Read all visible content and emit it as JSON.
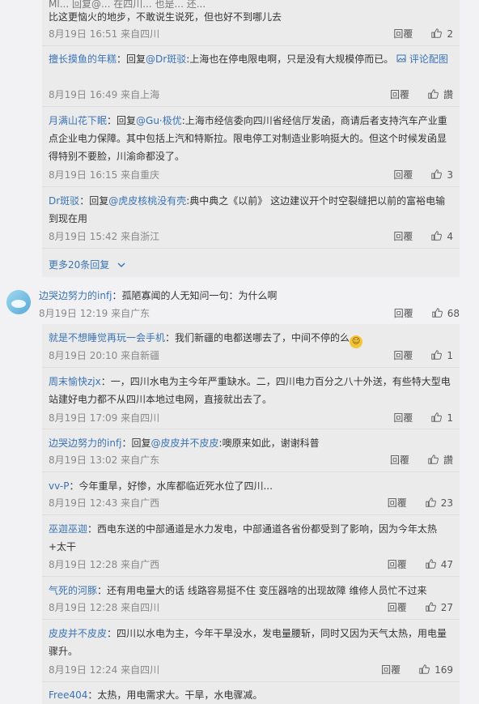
{
  "top_thread": {
    "partial_top_line": "Ml... 回复@... 在四川... 也是... 还...",
    "replies": [
      {
        "text": "比这更恼火的地步，不敢说生说死，但也好不到哪儿去",
        "date": "8月19日 16:51",
        "loc": "来自四川",
        "reply": "回覆",
        "likes": "2"
      },
      {
        "name": "擅长摸鱼的年糕",
        "mid": "：回复",
        "ref": "@Dr斑驳",
        "body": ":上海也在停电限电啊，只是没有大规模停而已。",
        "extra": "评论配图",
        "date": "8月19日 16:49",
        "loc": "来自上海",
        "reply": "回覆",
        "likes": "讚"
      },
      {
        "name": "月满山花下眠",
        "mid": "：回复",
        "ref": "@Gu·极优",
        "body": ":上海市经信委向四川省经信厅发函，商请后者支持汽车产业重点企业电力保障。其中包括上汽和特斯拉。限电停工对制造业影响挺大的。但这个时候发函显得特别不要脸，川渝命都没了。",
        "date": "8月19日 16:15",
        "loc": "来自重庆",
        "reply": "回覆",
        "likes": "3"
      },
      {
        "name": "Dr斑驳",
        "mid": "：回复",
        "ref": "@虎皮核桃没有壳",
        "body": ":典中典之《以前》 这边建议开个时空裂缝把以前的富裕电输到现在用",
        "date": "8月19日 15:42",
        "loc": "来自浙江",
        "reply": "回覆",
        "likes": "4"
      }
    ],
    "more_label": "更多20条回复"
  },
  "main_comment": {
    "name": "边哭边努力的infj",
    "text": "：孤陋寡闻的人无知问一句：为什么啊",
    "date": "8月19日 12:19",
    "loc": "来自广东",
    "reply": "回覆",
    "likes": "68"
  },
  "sub_replies": [
    {
      "name": "就是不想睡觉再玩一会手机",
      "text": "：我们新疆的电都送哪去了，中间不停的么",
      "date": "8月19日 20:10",
      "loc": "来自新疆",
      "reply": "回覆",
      "likes": "1"
    },
    {
      "name": "周末愉快zjx",
      "text": "：一，四川水电为主今年严重缺水。二，四川电力百分之八十外送，有些特大型电站建好电力都不从四川本地过电网，直接就出去了。",
      "date": "8月19日 17:09",
      "loc": "来自四川",
      "reply": "回覆",
      "likes": "1"
    },
    {
      "name": "边哭边努力的infj",
      "mid": "：回复",
      "ref": "@皮皮并不皮皮",
      "text": ":噢原来如此，谢谢科普",
      "date": "8月19日 13:02",
      "loc": "来自广东",
      "reply": "回覆",
      "likes": "讚"
    },
    {
      "name": "vv-P",
      "text": "：今年重旱，好惨，水库都临近死水位了四川...",
      "date": "8月19日 12:43",
      "loc": "来自广西",
      "reply": "回覆",
      "likes": "23"
    },
    {
      "name": "巫迦巫迦",
      "text": "：西电东送的中部通道是水力发电，中部通道各省份都受到了影响，因为今年太热+太干",
      "date": "8月19日 12:28",
      "loc": "来自广西",
      "reply": "回覆",
      "likes": "47"
    },
    {
      "name": "气死的河豚",
      "text": "：还有用电量大的话 线路容易挺不住 变压器啥的出现故障 维修人员忙不过来",
      "date": "8月19日 12:28",
      "loc": "来自四川",
      "reply": "回覆",
      "likes": "27"
    },
    {
      "name": "皮皮并不皮皮",
      "text": "：四川以水电为主，今年干旱没水，发电量腰斩，同时又因为天气太热，用电量骤升。",
      "date": "8月19日 12:24",
      "loc": "来自四川",
      "reply": "回覆",
      "likes": "169"
    },
    {
      "name": "Free404",
      "text": "：太热，用电需求大。干旱，水电骤减。"
    }
  ]
}
